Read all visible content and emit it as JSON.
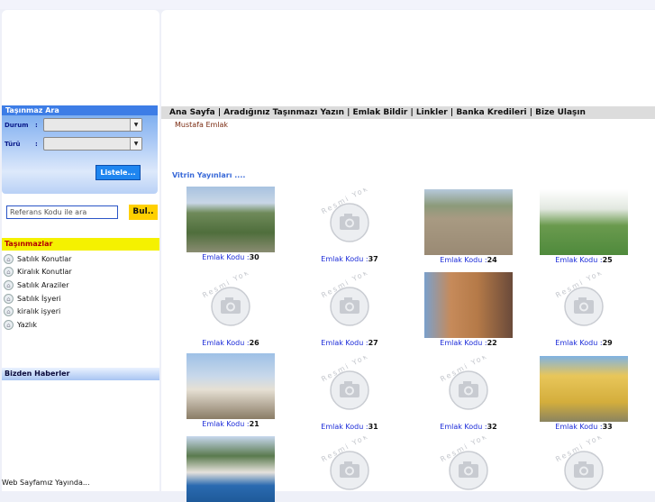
{
  "search": {
    "title": "Taşınmaz Ara",
    "durum_label": "Durum",
    "turu_label": "Türü",
    "durum_value": "",
    "turu_value": "",
    "list_button": "Listele...",
    "ref_placeholder": "Referans Kodu ile ara",
    "find_button": "Bul.."
  },
  "tasinmazlar": {
    "title": "Taşınmazlar",
    "items": [
      "Satılık Konutlar",
      "Kiralık Konutlar",
      "Satılık Araziler",
      "Satılık İşyeri",
      "kiralık işyeri",
      "Yazlık"
    ]
  },
  "haberler": {
    "title": "Bizden Haberler",
    "text": "Web Sayfamız Yayında..."
  },
  "nav": {
    "items": [
      "Ana Sayfa |",
      "Aradığınız Taşınmazı Yazın",
      "| Emlak Bildir |",
      "Linkler |",
      "Banka Kredileri",
      "| Bize Ulaşın"
    ]
  },
  "owner": "Mustafa Emlak",
  "vitrin_title": "Vitrin Yayınları ....",
  "listing_label": "Emlak Kodu :",
  "no_image_text": "Resmi Yok",
  "listings": [
    {
      "code": "30",
      "has_photo": true
    },
    {
      "code": "37",
      "has_photo": false
    },
    {
      "code": "24",
      "has_photo": true
    },
    {
      "code": "25",
      "has_photo": true
    },
    {
      "code": "26",
      "has_photo": false
    },
    {
      "code": "27",
      "has_photo": false
    },
    {
      "code": "22",
      "has_photo": true
    },
    {
      "code": "29",
      "has_photo": false
    },
    {
      "code": "21",
      "has_photo": true
    },
    {
      "code": "31",
      "has_photo": false
    },
    {
      "code": "32",
      "has_photo": false
    },
    {
      "code": "33",
      "has_photo": true
    },
    {
      "code": "",
      "has_photo": true
    },
    {
      "code": "",
      "has_photo": false
    },
    {
      "code": "",
      "has_photo": false
    },
    {
      "code": "",
      "has_photo": false
    }
  ],
  "colors": {
    "nav_bg": "#dcdcdc",
    "code_blue": "#1a2ad8",
    "tas_head_bg": "#f5f100",
    "tas_head_text": "#b30000"
  }
}
